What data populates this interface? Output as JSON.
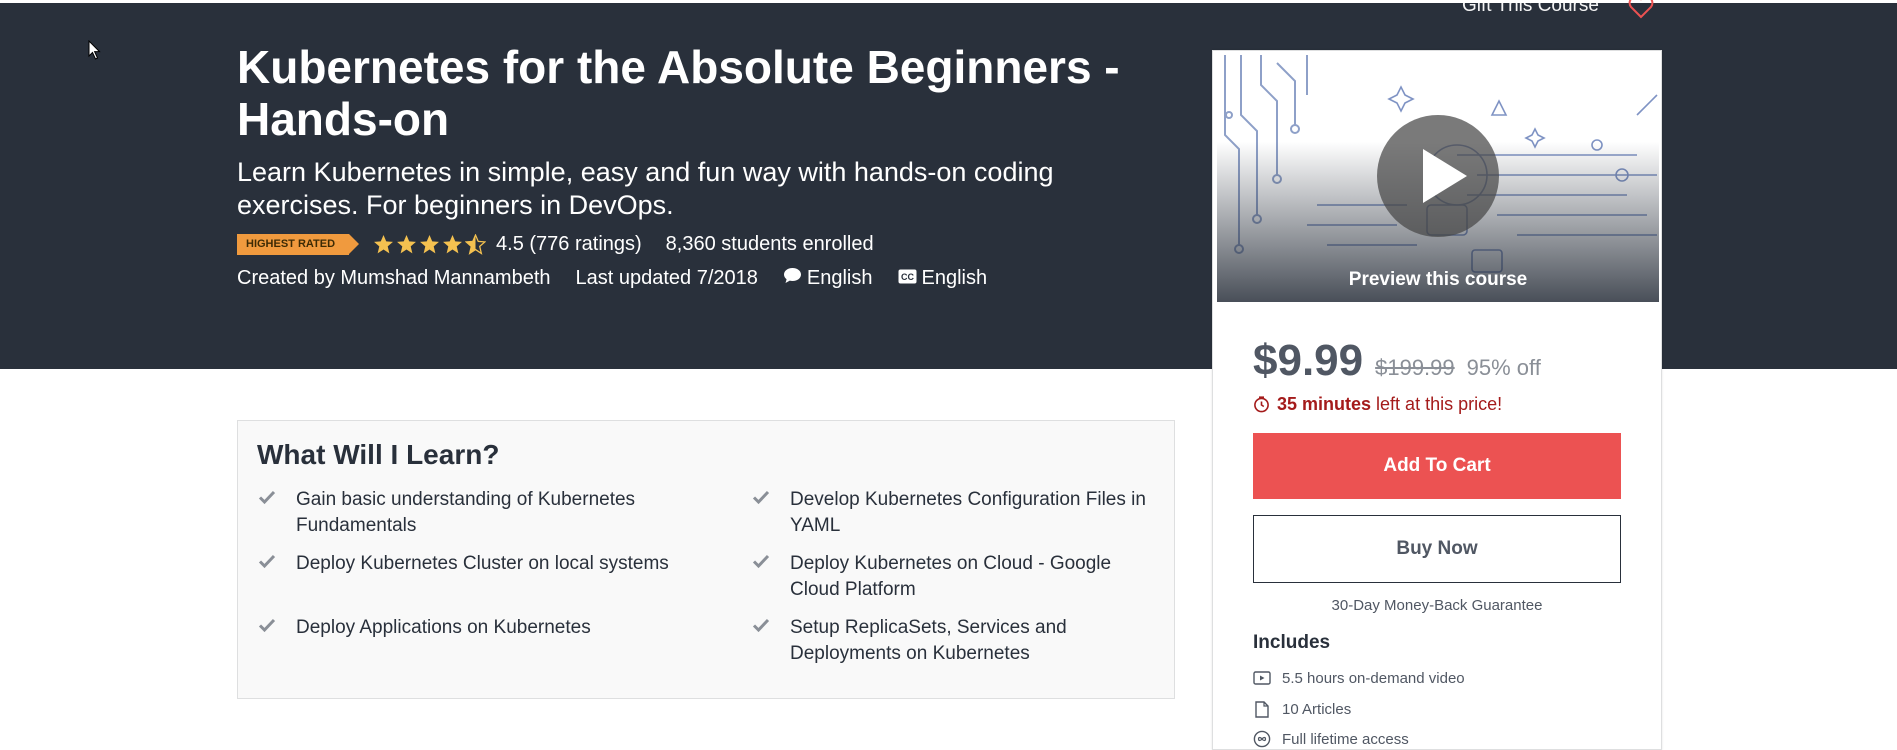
{
  "header": {
    "gift_link": "Gift This Course"
  },
  "course": {
    "title": "Kubernetes for the Absolute Beginners - Hands-on",
    "subtitle": "Learn Kubernetes in simple, easy and fun way with hands-on coding exercises. For beginners in DevOps.",
    "badge": "HIGHEST RATED",
    "rating_value": 4.5,
    "rating_text": "4.5 (776 ratings)",
    "enrolled": "8,360 students enrolled",
    "created_by": "Created by Mumshad Mannambeth",
    "last_updated": "Last updated 7/2018",
    "language": "English",
    "captions": "English"
  },
  "learn": {
    "heading": "What Will I Learn?",
    "items": [
      "Gain basic understanding of Kubernetes Fundamentals",
      "Develop Kubernetes Configuration Files in YAML",
      "Deploy Kubernetes Cluster on local systems",
      "Deploy Kubernetes on Cloud - Google Cloud Platform",
      "Deploy Applications on Kubernetes",
      "Setup ReplicaSets, Services and Deployments on Kubernetes"
    ]
  },
  "card": {
    "preview_label": "Preview this course",
    "price": "$9.99",
    "original_price": "$199.99",
    "discount": "95% off",
    "timer_bold": "35 minutes",
    "timer_rest": "left at this price!",
    "add_to_cart": "Add To Cart",
    "buy_now": "Buy Now",
    "guarantee": "30-Day Money-Back Guarantee",
    "includes_heading": "Includes",
    "includes": [
      "5.5 hours on-demand video",
      "10 Articles",
      "Full lifetime access"
    ]
  },
  "colors": {
    "hero_bg": "#29303b",
    "badge": "#f09a3e",
    "star": "#f4c150",
    "cart_button": "#ec5252",
    "timer_red": "#a41b1b"
  },
  "icons": [
    "cursor-icon",
    "heart-icon",
    "star-icon",
    "speech-bubble-icon",
    "closed-captions-icon",
    "check-icon",
    "play-icon",
    "alarm-clock-icon",
    "video-icon",
    "article-icon",
    "infinity-icon"
  ]
}
